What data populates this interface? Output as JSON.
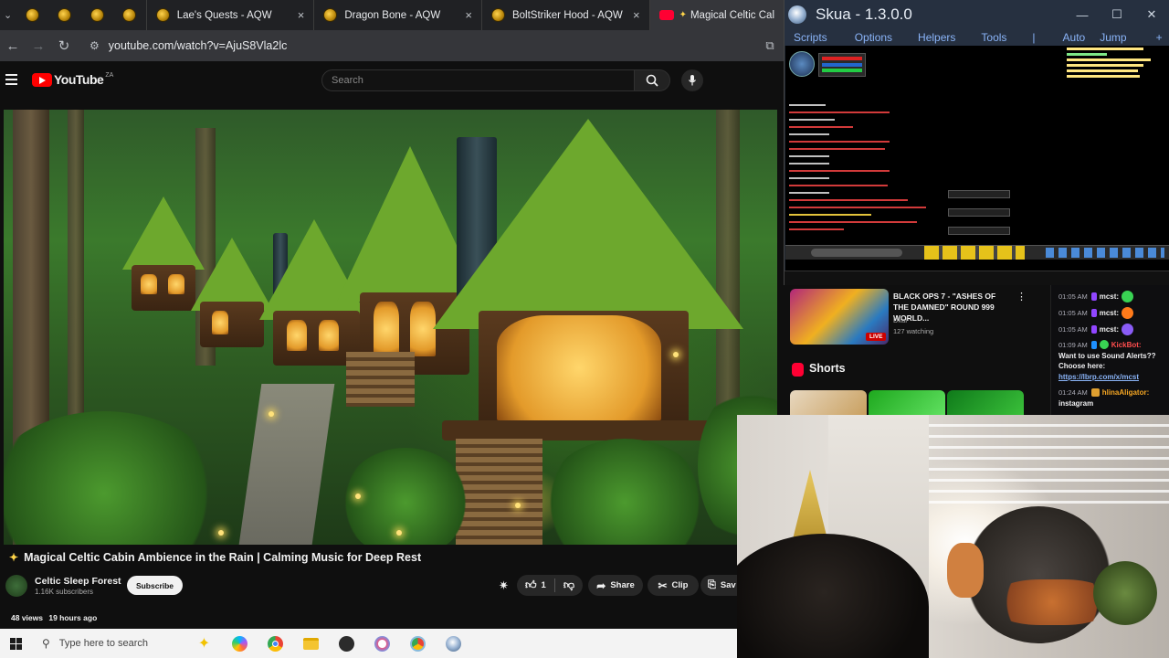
{
  "browser": {
    "tabs": [
      {
        "title": "Lae's Quests - AQW",
        "close": "×"
      },
      {
        "title": "Dragon Bone - AQW",
        "close": "×"
      },
      {
        "title": "BoltStriker Hood - AQW",
        "close": "×"
      },
      {
        "title": "Magical Celtic Cal"
      }
    ],
    "url": "youtube.com/watch?v=AjuS8Vla2lc"
  },
  "youtube": {
    "logo_text": "YouTube",
    "region": "ZA",
    "search_placeholder": "Search",
    "video": {
      "title": "Magical Celtic Cabin Ambience in the Rain | Calming Music for Deep Rest",
      "channel": "Celtic Sleep Forest",
      "subscribers": "1.16K subscribers",
      "subscribe_label": "Subscribe",
      "likes": "1",
      "share_label": "Share",
      "clip_label": "Clip",
      "save_label": "Sav",
      "views": "48 views",
      "age": "19 hours ago"
    },
    "related": {
      "title": "BLACK OPS 7 - \"ASHES OF THE DAMNED\" ROUND 999 WORLD...",
      "channel": "Dkal",
      "watching": "127 watching",
      "live_badge": "LIVE"
    },
    "shorts_title": "Shorts"
  },
  "skua": {
    "title": "Skua - 1.3.0.0",
    "menu": [
      "Scripts",
      "Options",
      "Helpers",
      "Tools",
      "|",
      "Auto",
      "Jump",
      "+"
    ],
    "controls": {
      "minimize": "—",
      "maximize": "☐",
      "close": "✕"
    }
  },
  "chat": {
    "messages": [
      {
        "time": "01:05 AM",
        "user": "mcst:",
        "color": "#ffffff",
        "badge": "#9146ff",
        "emote": "#39d353"
      },
      {
        "time": "01:05 AM",
        "user": "mcst:",
        "color": "#ffffff",
        "badge": "#9146ff",
        "emote": "#ff7a1a"
      },
      {
        "time": "01:05 AM",
        "user": "mcst:",
        "color": "#ffffff",
        "badge": "#9146ff",
        "emote": "#8a5cf6"
      },
      {
        "time": "01:09 AM",
        "user": "KickBot:",
        "color": "#ff4d4d",
        "badge": "#1e90ff",
        "emote": "#39d353"
      },
      {
        "time": "01:24 AM",
        "user": "hlinaAligator:",
        "color": "#f5a623",
        "badge": "#e0a030",
        "emote": ""
      }
    ],
    "kickbot_text": "Want to use Sound Alerts?? Choose here:",
    "kickbot_link": "https://lbrp.com/x/mcst",
    "hlina_text": "instagram"
  },
  "taskbar": {
    "search_placeholder": "Type here to search"
  },
  "colors": {
    "youtube_red": "#ff0000",
    "skua_accent": "#8ab4f8"
  }
}
